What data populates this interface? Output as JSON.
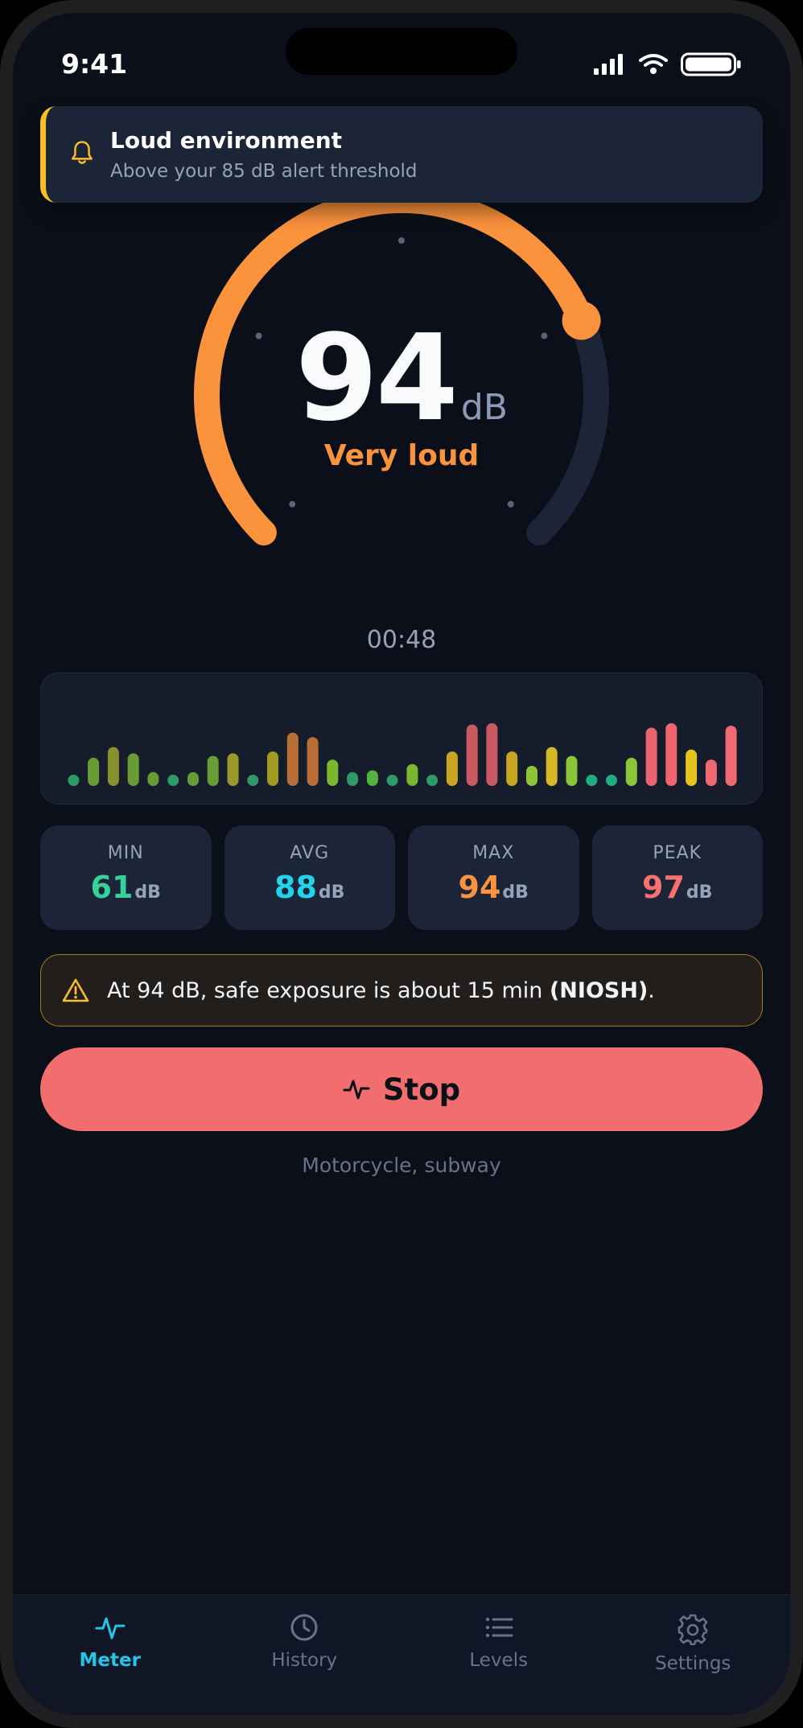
{
  "status_bar": {
    "time": "9:41"
  },
  "alert": {
    "title": "Loud environment",
    "subtitle": "Above your 85 dB alert threshold",
    "accent": "#fbbf24"
  },
  "reading": {
    "value": "94",
    "unit": "dB",
    "label": "Very loud",
    "level_fraction": 0.75,
    "color": "#fb923c"
  },
  "timer": "00:48",
  "histogram": {
    "values": [
      0.18,
      0.45,
      0.62,
      0.52,
      0.22,
      0.12,
      0.22,
      0.48,
      0.52,
      0.18,
      0.55,
      0.85,
      0.78,
      0.42,
      0.22,
      0.25,
      0.18,
      0.35,
      0.16,
      0.55,
      0.98,
      1.0,
      0.55,
      0.32,
      0.62,
      0.48,
      0.14,
      0.12,
      0.45,
      0.93,
      1.0,
      0.58,
      0.42,
      0.96
    ],
    "colors": [
      "#2e9a6a",
      "#6a9c35",
      "#8a8f30",
      "#6a9c35",
      "#6a9c35",
      "#2e9a6a",
      "#6a9c35",
      "#6a9c35",
      "#9a9a2a",
      "#2e9a6a",
      "#a09a22",
      "#b86e34",
      "#b86e34",
      "#77b830",
      "#2e9a6a",
      "#55b140",
      "#2e9a6a",
      "#77b830",
      "#2e9a6a",
      "#c8a622",
      "#c95a62",
      "#c95a62",
      "#c8a622",
      "#8cc43a",
      "#d4b826",
      "#8cc43a",
      "#1fae80",
      "#1fae80",
      "#8cc43a",
      "#ea6470",
      "#ee6570",
      "#e6c21c",
      "#f06872",
      "#f16a72"
    ]
  },
  "stats": [
    {
      "label": "MIN",
      "value": "61",
      "unit": "dB",
      "color": "#34d399"
    },
    {
      "label": "AVG",
      "value": "88",
      "unit": "dB",
      "color": "#22d3ee"
    },
    {
      "label": "MAX",
      "value": "94",
      "unit": "dB",
      "color": "#fb923c"
    },
    {
      "label": "PEAK",
      "value": "97",
      "unit": "dB",
      "color": "#f87171"
    }
  ],
  "warning": {
    "pre": "At 94 dB, safe exposure is about 15 min ",
    "bold": "(NIOSH)",
    "post": "."
  },
  "stop_button": {
    "label": "Stop",
    "color": "#f26d6d"
  },
  "example": "Motorcycle, subway",
  "tabs": [
    {
      "label": "Meter",
      "icon": "pulse-icon",
      "active": true
    },
    {
      "label": "History",
      "icon": "clock-icon",
      "active": false
    },
    {
      "label": "Levels",
      "icon": "list-icon",
      "active": false
    },
    {
      "label": "Settings",
      "icon": "gear-icon",
      "active": false
    }
  ],
  "accent": "#22c6e6"
}
